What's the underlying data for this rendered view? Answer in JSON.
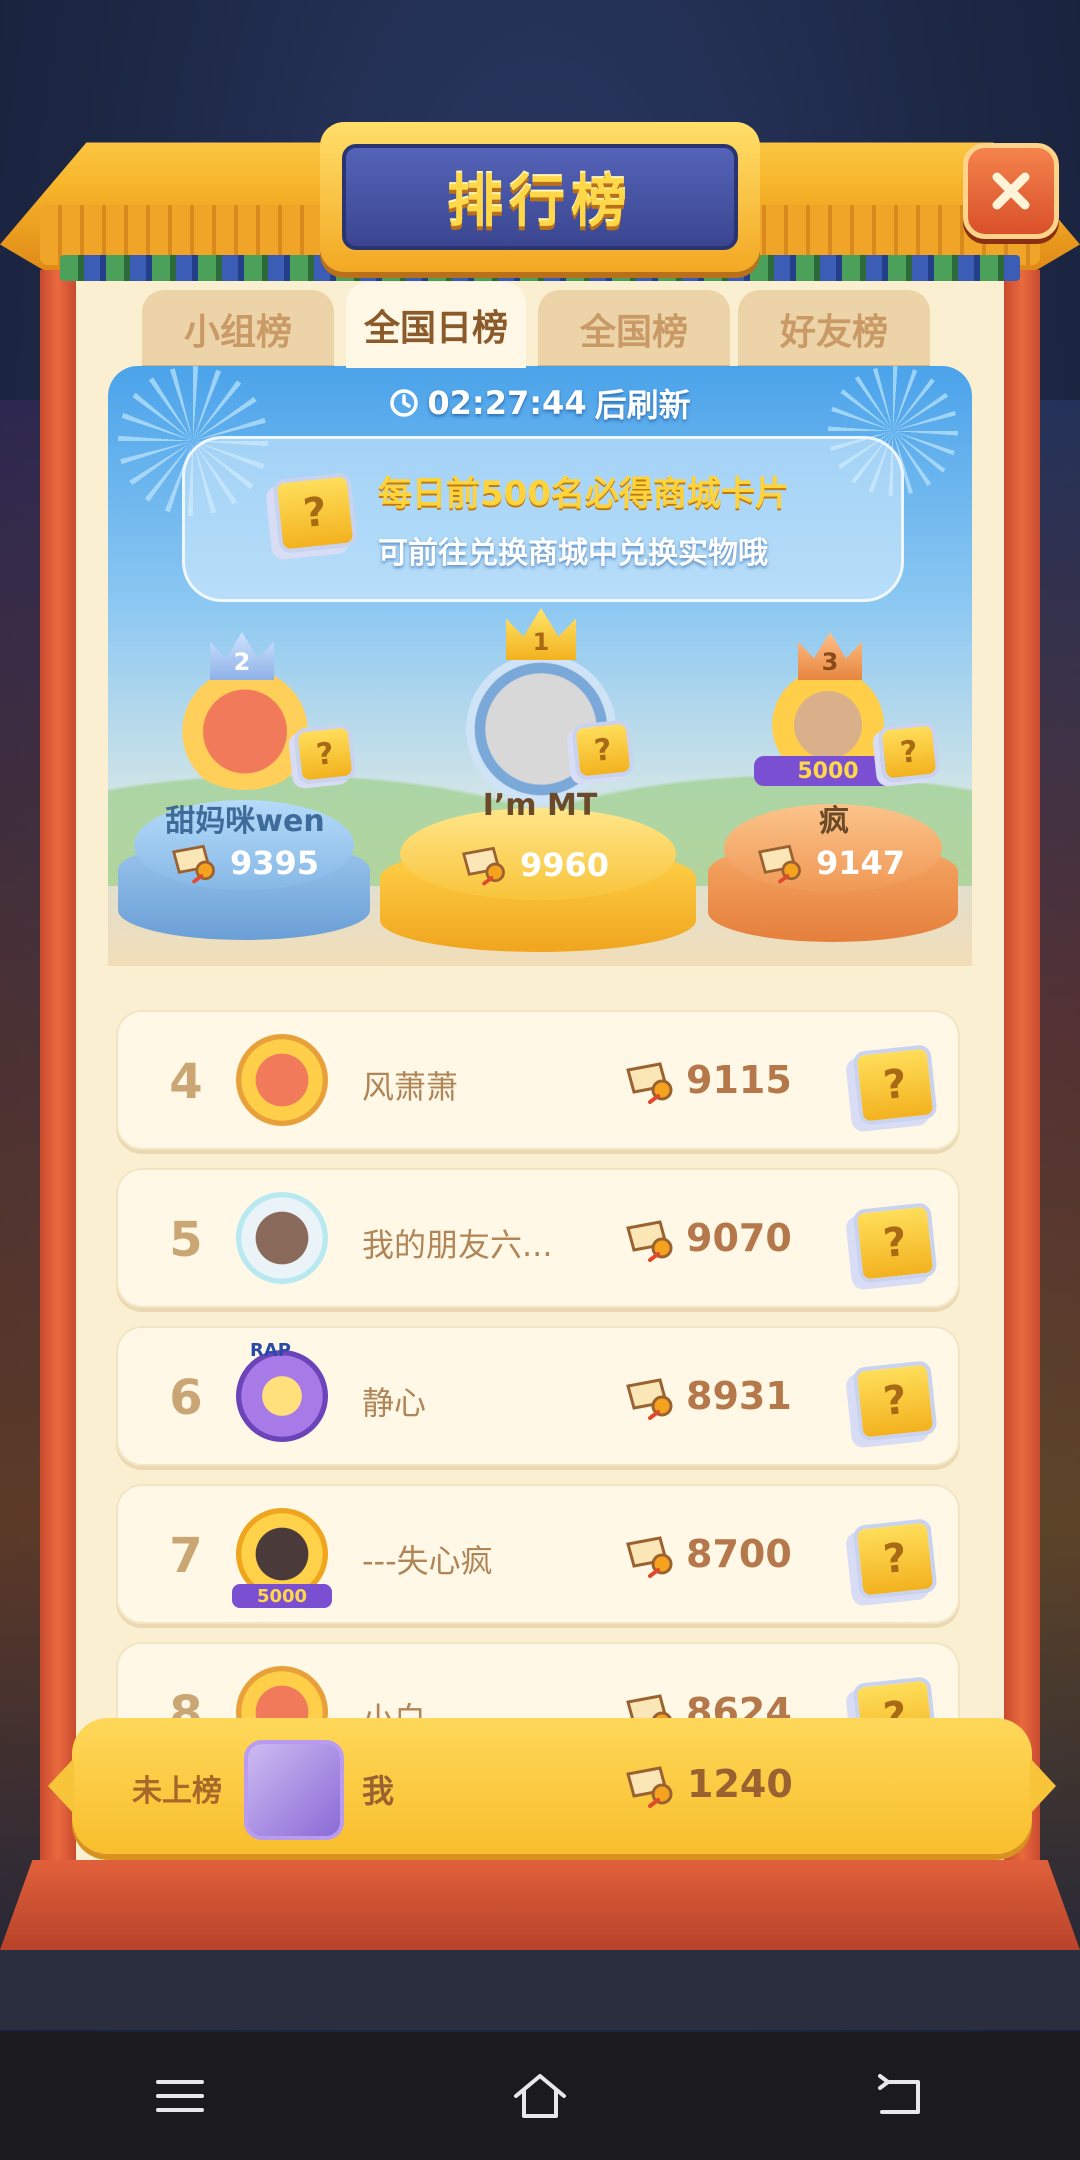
{
  "title": "排行榜",
  "tabs": [
    {
      "label": "小组榜",
      "active": false
    },
    {
      "label": "全国日榜",
      "active": true
    },
    {
      "label": "全国榜",
      "active": false
    },
    {
      "label": "好友榜",
      "active": false
    }
  ],
  "timer": {
    "time": "02:27:44",
    "suffix": "后刷新"
  },
  "notice": {
    "line1": "每日前500名必得商城卡片",
    "line2": "可前往兑换商城中兑换实物哦",
    "icon": "question-card-icon"
  },
  "podium": {
    "first": {
      "rank": "1",
      "name": "I’m MT",
      "score": "9960"
    },
    "second": {
      "rank": "2",
      "name": "甜妈咪wen",
      "score": "9395"
    },
    "third": {
      "rank": "3",
      "name": "疯",
      "score": "9147",
      "badge": "5000"
    }
  },
  "rows": [
    {
      "rank": "4",
      "name": "风萧萧",
      "score": "9115"
    },
    {
      "rank": "5",
      "name": "我的朋友六...",
      "score": "9070"
    },
    {
      "rank": "6",
      "name": "静心",
      "score": "8931",
      "badge": "RAP"
    },
    {
      "rank": "7",
      "name": "---失心疯",
      "score": "8700",
      "badge": "5000"
    },
    {
      "rank": "8",
      "name": "小白",
      "score": "8624"
    }
  ],
  "me": {
    "rank_label": "未上榜",
    "name": "我",
    "score": "1240"
  },
  "question_mark": "?",
  "colors": {
    "accent": "#f8be2c",
    "tab_active_text": "#8a5a2a",
    "score_text": "#b5784a"
  },
  "nav": {
    "menu_icon": "menu-icon",
    "home_icon": "home-icon",
    "back_icon": "back-icon"
  }
}
